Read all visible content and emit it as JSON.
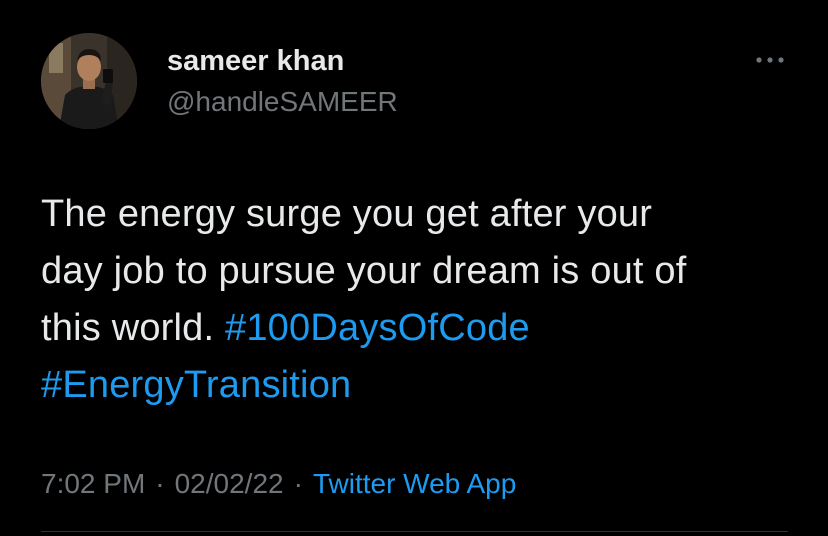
{
  "user": {
    "display_name": "sameer khan",
    "handle": "@handleSAMEER",
    "avatar_icon": "profile-photo"
  },
  "menu": {
    "more_icon": "more-horizontal-icon"
  },
  "tweet": {
    "line1": "The energy surge you get after your",
    "line2": "day job to pursue your dream is out of",
    "line3_text": "this world. ",
    "hashtag1": "#100DaysOfCode",
    "hashtag2": "#EnergyTransition"
  },
  "meta": {
    "time": "7:02 PM",
    "separator": "·",
    "date": "02/02/22",
    "source": "Twitter Web App"
  },
  "colors": {
    "background": "#000000",
    "text": "#e7e9ea",
    "secondary": "#71767b",
    "link": "#1d9bf0",
    "divider": "#2f3336"
  }
}
